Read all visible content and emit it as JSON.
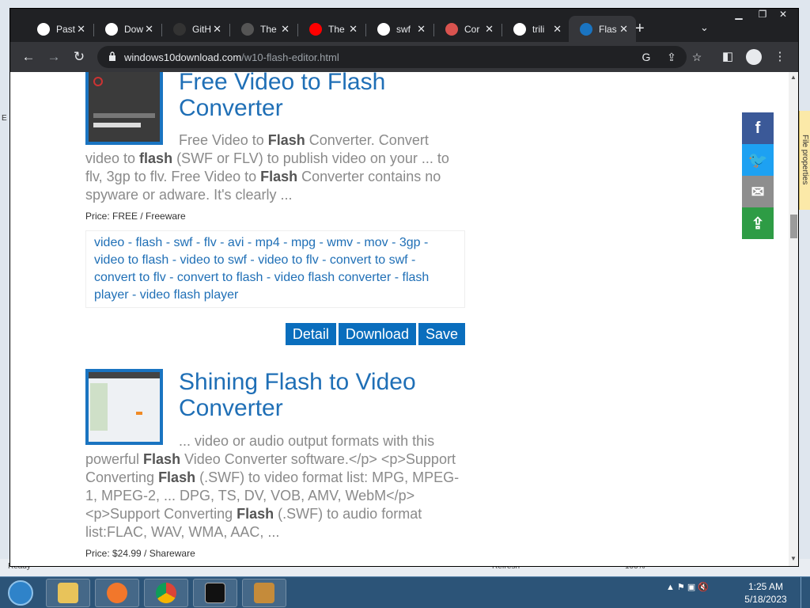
{
  "background": {
    "left_text": "E",
    "right_tab": "File properties",
    "status_ready": "Ready",
    "status_refresh": "Refresh",
    "status_zoom": "100%"
  },
  "tabs": [
    {
      "title": "Past",
      "icon": "globe-icon",
      "color": "#ffffff"
    },
    {
      "title": "Dow",
      "icon": "download-icon",
      "color": "#ffffff"
    },
    {
      "title": "GitH",
      "icon": "github-icon",
      "color": "#333333"
    },
    {
      "title": "The",
      "icon": "bug-icon",
      "color": "#555555"
    },
    {
      "title": "The",
      "icon": "youtube-icon",
      "color": "#ff0000"
    },
    {
      "title": "swf",
      "icon": "google-icon",
      "color": "#ffffff"
    },
    {
      "title": "Cor",
      "icon": "tree-icon",
      "color": "#d9534f"
    },
    {
      "title": "trili",
      "icon": "google-icon",
      "color": "#ffffff"
    },
    {
      "title": "Flas",
      "icon": "w10-icon",
      "color": "#1a74c1"
    }
  ],
  "address": {
    "domain": "windows10download.com",
    "path": "/w10-flash-editor.html"
  },
  "items": [
    {
      "title": "Free Video to Flash Converter",
      "desc_parts": [
        {
          "t": "Free Video to ",
          "b": false
        },
        {
          "t": "Flash",
          "b": true
        },
        {
          "t": " Converter. Convert video to ",
          "b": false
        },
        {
          "t": "flash",
          "b": true
        },
        {
          "t": " (SWF or FLV) to publish video on your ... to flv, 3gp to flv. Free Video to ",
          "b": false
        },
        {
          "t": "Flash",
          "b": true
        },
        {
          "t": " Converter contains no spyware or adware. It's clearly ...",
          "b": false
        }
      ],
      "price": "Price: FREE / Freeware",
      "tags": [
        "video",
        "flash",
        "swf",
        "flv",
        "avi",
        "mp4",
        "mpg",
        "wmv",
        "mov",
        "3gp",
        "video to flash",
        "video to swf",
        "video to flv",
        "convert to swf",
        "convert to flv",
        "convert to flash",
        "video flash converter",
        "flash player",
        "video flash player"
      ],
      "buttons": [
        "Detail",
        "Download",
        "Save"
      ]
    },
    {
      "title": "Shining Flash to Video Converter",
      "desc_parts": [
        {
          "t": "... video or audio output formats with this powerful ",
          "b": false
        },
        {
          "t": "Flash",
          "b": true
        },
        {
          "t": " Video Converter software.</p> <p>Support Converting ",
          "b": false
        },
        {
          "t": "Flash",
          "b": true
        },
        {
          "t": " (.SWF) to video format list: MPG, MPEG-1, MPEG-2, ... DPG, TS, DV, VOB, AMV, WebM</p> <p>Support Converting ",
          "b": false
        },
        {
          "t": "Flash",
          "b": true
        },
        {
          "t": " (.SWF) to audio format list:FLAC, WAV, WMA, AAC, ...",
          "b": false
        }
      ],
      "price": "Price: $24.99 / Shareware"
    }
  ],
  "share": [
    {
      "name": "facebook",
      "glyph": "f",
      "color": "#3b5998"
    },
    {
      "name": "twitter",
      "glyph": "🐦",
      "color": "#1da1f2"
    },
    {
      "name": "email",
      "glyph": "✉",
      "color": "#8e8e8e"
    },
    {
      "name": "more",
      "glyph": "⇪",
      "color": "#2e9c45"
    }
  ],
  "taskbar": {
    "time": "1:25 AM",
    "date": "5/18/2023",
    "apps": [
      "explorer",
      "firefox",
      "chrome",
      "cmd",
      "archive"
    ]
  }
}
